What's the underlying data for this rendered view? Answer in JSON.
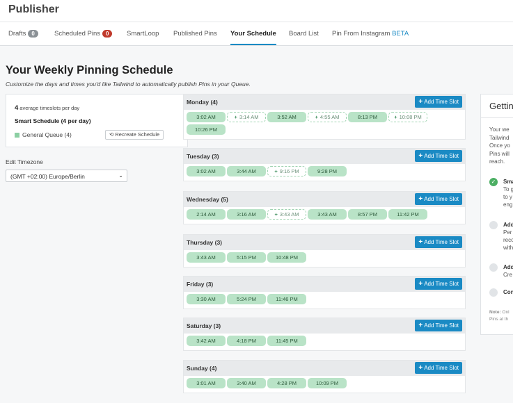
{
  "app": {
    "title": "Publisher"
  },
  "tabs": [
    {
      "label": "Drafts",
      "badge": "0",
      "badge_color": "#8b9196"
    },
    {
      "label": "Scheduled Pins",
      "badge": "0",
      "badge_color": "#c0392b"
    },
    {
      "label": "SmartLoop"
    },
    {
      "label": "Published Pins"
    },
    {
      "label": "Your Schedule",
      "active": true
    },
    {
      "label": "Board List"
    },
    {
      "label": "Pin From Instagram",
      "tag": "BETA"
    }
  ],
  "page": {
    "title": "Your Weekly Pinning Schedule",
    "subtitle": "Customize the days and times you'd like Tailwind to automatically publish Pins in your Queue."
  },
  "summary": {
    "avg_count": "4",
    "avg_label": "average timeslots per day",
    "smart_label": "Smart Schedule (4 per day)",
    "queue_label": "General Queue (4)",
    "recreate_label": "Recreate Schedule"
  },
  "timezone": {
    "label": "Edit Timezone",
    "value": "(GMT +02:00) Europe/Berlin"
  },
  "add_label": "Add Time Slot",
  "colors": {
    "accent": "#1a8ac4",
    "slot_fill": "#b9e3c7",
    "badge_red": "#c0392b"
  },
  "days": [
    {
      "name": "Monday (4)",
      "slots": [
        {
          "time": "3:02 AM",
          "filled": true
        },
        {
          "time": "3:14 AM",
          "filled": false
        },
        {
          "time": "3:52 AM",
          "filled": true
        },
        {
          "time": "4:55 AM",
          "filled": false
        },
        {
          "time": "8:13 PM",
          "filled": true
        },
        {
          "time": "10:08 PM",
          "filled": false
        },
        {
          "time": "10:26 PM",
          "filled": true
        }
      ]
    },
    {
      "name": "Tuesday (3)",
      "slots": [
        {
          "time": "3:02 AM",
          "filled": true
        },
        {
          "time": "3:44 AM",
          "filled": true
        },
        {
          "time": "9:16 PM",
          "filled": false
        },
        {
          "time": "9:28 PM",
          "filled": true
        }
      ]
    },
    {
      "name": "Wednesday (5)",
      "slots": [
        {
          "time": "2:14 AM",
          "filled": true
        },
        {
          "time": "3:16 AM",
          "filled": true
        },
        {
          "time": "3:43 AM",
          "filled": false
        },
        {
          "time": "3:43 AM",
          "filled": true
        },
        {
          "time": "8:57 PM",
          "filled": true
        },
        {
          "time": "11:42 PM",
          "filled": true
        }
      ]
    },
    {
      "name": "Thursday (3)",
      "slots": [
        {
          "time": "3:43 AM",
          "filled": true
        },
        {
          "time": "5:15 PM",
          "filled": true
        },
        {
          "time": "10:48 PM",
          "filled": true
        }
      ]
    },
    {
      "name": "Friday (3)",
      "slots": [
        {
          "time": "3:30 AM",
          "filled": true
        },
        {
          "time": "5:24 PM",
          "filled": true
        },
        {
          "time": "11:46 PM",
          "filled": true
        }
      ]
    },
    {
      "name": "Saturday (3)",
      "slots": [
        {
          "time": "3:42 AM",
          "filled": true
        },
        {
          "time": "4:18 PM",
          "filled": true
        },
        {
          "time": "11:45 PM",
          "filled": true
        }
      ]
    },
    {
      "name": "Sunday (4)",
      "slots": [
        {
          "time": "3:01 AM",
          "filled": true
        },
        {
          "time": "3:40 AM",
          "filled": true
        },
        {
          "time": "4:28 PM",
          "filled": true
        },
        {
          "time": "10:09 PM",
          "filled": true
        }
      ]
    }
  ],
  "getting_started": {
    "title": "Gettin",
    "intro": [
      "Your we",
      "Tailwind",
      "Once yo",
      "Pins will",
      "reach."
    ],
    "steps": [
      {
        "lines": [
          "Sma",
          "To g",
          "to y",
          "eng"
        ],
        "done": true
      },
      {
        "lines": [
          "Add",
          "Per",
          "reco",
          "with"
        ],
        "done": false
      },
      {
        "lines": [
          "Add",
          "Cre"
        ],
        "done": false
      },
      {
        "lines": [
          "Con"
        ],
        "done": false
      }
    ],
    "note_label": "Note:",
    "note_lines": [
      " Onl",
      "Pins at th"
    ]
  }
}
